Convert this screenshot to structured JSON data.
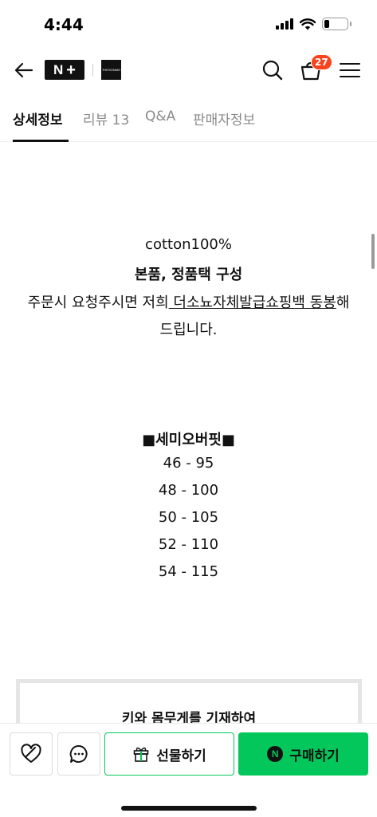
{
  "status_bar": {
    "time": "4:44"
  },
  "header": {
    "nplus_logo_text": "N",
    "nplus_logo_plus": "+",
    "store_logo_text": "THESONMO",
    "cart_badge_count": "27",
    "icons": [
      "back-arrow-icon",
      "search-icon",
      "cart-icon",
      "menu-icon"
    ]
  },
  "tabs": [
    {
      "label": "상세정보",
      "active": true
    },
    {
      "label": "리뷰 13",
      "active": false
    },
    {
      "label": "Q&A",
      "active": false
    },
    {
      "label": "판매자정보",
      "active": false
    }
  ],
  "detail": {
    "material": "cotton100%",
    "composition": "본품, 정품택 구성",
    "notice_prefix": "주문시 요청주시면 저희",
    "notice_underlined": " 더소뇨자체발급쇼핑백 동봉",
    "notice_suffix": "해",
    "notice_line2": "드립니다.",
    "fit_title": "■세미오버핏■",
    "sizes": [
      "46 - 95",
      "48 - 100",
      "50 - 105",
      "52 - 110",
      "54 - 115"
    ],
    "size_box_text": "키와 몸무게를 기재하여"
  },
  "bottom_bar": {
    "gift_label": "선물하기",
    "buy_label": "구매하기",
    "buy_icon_text": "N",
    "icons": [
      "wishlist-heart-icon",
      "chat-bubble-icon",
      "gift-box-icon"
    ]
  },
  "colors": {
    "naver_green": "#03c75a",
    "badge_red": "#f8431d",
    "text": "#111111",
    "inactive_tab": "#8a8a8a"
  }
}
